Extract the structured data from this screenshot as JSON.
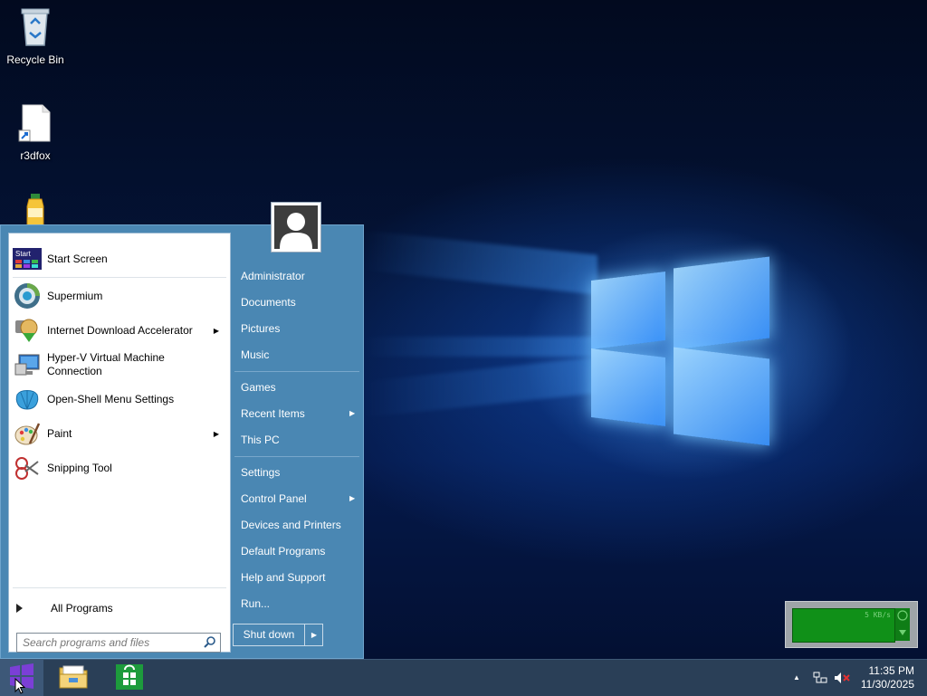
{
  "desktop": {
    "icons": [
      {
        "label": "Recycle Bin",
        "icon": "recycle-bin-icon"
      },
      {
        "label": "r3dfox",
        "icon": "document-shortcut-icon"
      },
      {
        "label": "",
        "icon": "juice-bottle-icon"
      }
    ]
  },
  "start_menu": {
    "pinned": [
      {
        "label": "Start Screen",
        "icon": "start-screen-icon",
        "submenu": false
      },
      {
        "label": "Supermium",
        "icon": "supermium-icon",
        "submenu": false
      },
      {
        "label": "Internet Download Accelerator",
        "icon": "download-accelerator-icon",
        "submenu": true
      },
      {
        "label_line1": "Hyper-V Virtual Machine",
        "label_line2": "Connection",
        "icon": "hyperv-icon",
        "submenu": false
      },
      {
        "label": "Open-Shell Menu Settings",
        "icon": "shell-icon",
        "submenu": false
      },
      {
        "label": "Paint",
        "icon": "paint-palette-icon",
        "submenu": true
      },
      {
        "label": "Snipping Tool",
        "icon": "scissors-icon",
        "submenu": false
      }
    ],
    "all_programs": "All Programs",
    "search_placeholder": "Search programs and files",
    "right_items": [
      {
        "label": "Administrator",
        "submenu": false
      },
      {
        "label": "Documents",
        "submenu": false
      },
      {
        "label": "Pictures",
        "submenu": false
      },
      {
        "label": "Music",
        "submenu": false
      },
      {
        "label": "Games",
        "submenu": false
      },
      {
        "label": "Recent Items",
        "submenu": true
      },
      {
        "label": "This PC",
        "submenu": false
      },
      {
        "label": "Settings",
        "submenu": false
      },
      {
        "label": "Control Panel",
        "submenu": true
      },
      {
        "label": "Devices and Printers",
        "submenu": false
      },
      {
        "label": "Default Programs",
        "submenu": false
      },
      {
        "label": "Help and Support",
        "submenu": false
      },
      {
        "label": "Run...",
        "submenu": false
      }
    ],
    "shutdown_label": "Shut down"
  },
  "widget": {
    "label": "5 KB/s"
  },
  "taskbar": {
    "buttons": [
      {
        "icon": "windows-start-icon"
      },
      {
        "icon": "file-explorer-icon"
      },
      {
        "icon": "store-icon"
      }
    ],
    "clock_time": "11:35 PM",
    "clock_date": "11/30/2025"
  },
  "colors": {
    "menu_blue": "#4a87b3",
    "taskbar": "#2a3f57",
    "widget_green": "#109018"
  }
}
